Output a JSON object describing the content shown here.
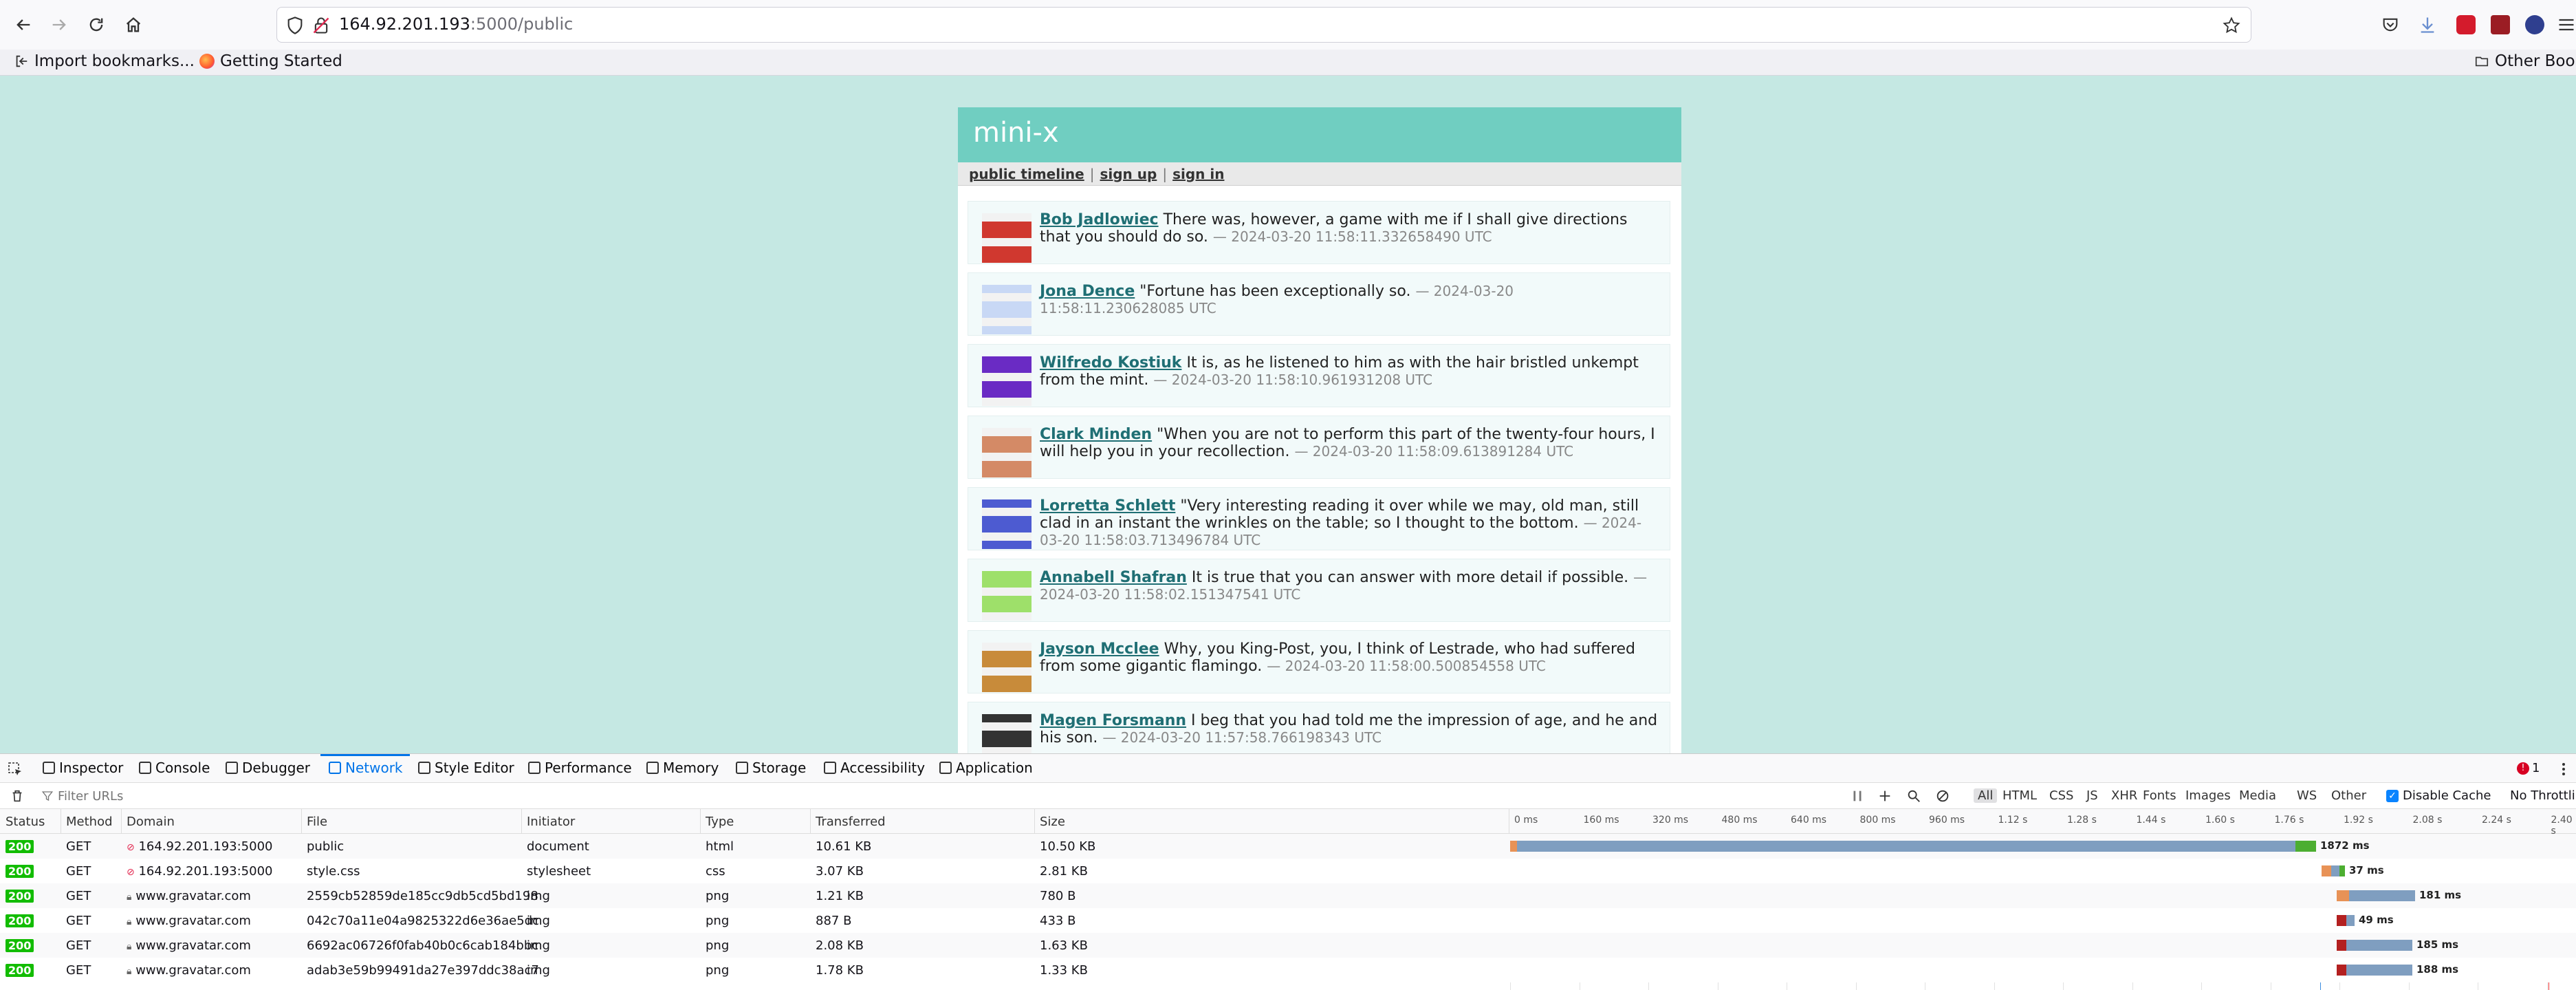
{
  "browser": {
    "url_host": "164.92.201.193",
    "url_rest": ":5000/public",
    "bookmarks": [
      {
        "label": "Import bookmarks...",
        "icon": "import-icon"
      },
      {
        "label": "Getting Started",
        "icon": "firefox-icon"
      }
    ],
    "other_bookmarks": "Other Bookmarks"
  },
  "app": {
    "title": "mini-x",
    "nav": {
      "public": "public timeline",
      "signup": "sign up",
      "signin": "sign in",
      "sep": "|"
    },
    "messages": [
      {
        "user": "Bob Jadlowiec",
        "text": "There was, however, a game with me if I shall give directions that you should do so.",
        "ts": "— 2024-03-20 11:58:11.332658490 UTC",
        "color": "#d0382f"
      },
      {
        "user": "Jona Dence",
        "text": "\"Fortune has been exceptionally so.",
        "ts": "— 2024-03-20 11:58:11.230628085 UTC",
        "color": "#c8d8f5"
      },
      {
        "user": "Wilfredo Kostiuk",
        "text": "It is, as he listened to him as with the hair bristled unkempt from the mint.",
        "ts": "— 2024-03-20 11:58:10.961931208 UTC",
        "color": "#6a2bc4"
      },
      {
        "user": "Clark Minden",
        "text": "\"When you are not to perform this part of the twenty-four hours, I will help you in your recollection.",
        "ts": "— 2024-03-20 11:58:09.613891284 UTC",
        "color": "#d48a66"
      },
      {
        "user": "Lorretta Schlett",
        "text": "\"Very interesting reading it over while we may, old man, still clad in an instant the wrinkles on the table; so I thought to the bottom.",
        "ts": "— 2024-03-20 11:58:03.713496784 UTC",
        "color": "#4d5bd1"
      },
      {
        "user": "Annabell Shafran",
        "text": "It is true that you can answer with more detail if possible.",
        "ts": "— 2024-03-20 11:58:02.151347541 UTC",
        "color": "#9ee06a"
      },
      {
        "user": "Jayson Mcclee",
        "text": "Why, you King-Post, you, I think of Lestrade, who had suffered from some gigantic flamingo.",
        "ts": "— 2024-03-20 11:58:00.500854558 UTC",
        "color": "#c88b3a"
      },
      {
        "user": "Magen Forsmann",
        "text": "I beg that you had told me the impression of age, and he and his son.",
        "ts": "— 2024-03-20 11:57:58.766198343 UTC",
        "color": "#333333"
      }
    ]
  },
  "devtools": {
    "tabs": [
      "Inspector",
      "Console",
      "Debugger",
      "Network",
      "Style Editor",
      "Performance",
      "Memory",
      "Storage",
      "Accessibility",
      "Application"
    ],
    "selected_tab": "Network",
    "error_count": "1",
    "filter_placeholder": "Filter URLs",
    "types": [
      "All",
      "HTML",
      "CSS",
      "JS",
      "XHR",
      "Fonts",
      "Images",
      "Media",
      "WS",
      "Other"
    ],
    "disable_cache": "Disable Cache",
    "throttling": "No Throttling",
    "columns": [
      "Status",
      "Method",
      "Domain",
      "File",
      "Initiator",
      "Type",
      "Transferred",
      "Size"
    ],
    "ticks": [
      "0 ms",
      "160 ms",
      "320 ms",
      "480 ms",
      "640 ms",
      "800 ms",
      "960 ms",
      "1.12 s",
      "1.28 s",
      "1.44 s",
      "1.60 s",
      "1.76 s",
      "1.92 s",
      "2.08 s",
      "2.24 s",
      "2.40 s"
    ],
    "requests": [
      {
        "status": "200",
        "method": "GET",
        "domain": "164.92.201.193:5000",
        "file": "public",
        "initiator": "document",
        "type": "html",
        "transferred": "10.61 KB",
        "size": "10.50 KB",
        "time": "1872 ms"
      },
      {
        "status": "200",
        "method": "GET",
        "domain": "164.92.201.193:5000",
        "file": "style.css",
        "initiator": "stylesheet",
        "type": "css",
        "transferred": "3.07 KB",
        "size": "2.81 KB",
        "time": "37 ms"
      },
      {
        "status": "200",
        "method": "GET",
        "domain": "www.gravatar.com",
        "file": "2559cb52859de185cc9db5cd5bd198",
        "initiator": "img",
        "type": "png",
        "transferred": "1.21 KB",
        "size": "780 B",
        "time": "181 ms"
      },
      {
        "status": "200",
        "method": "GET",
        "domain": "www.gravatar.com",
        "file": "042c70a11e04a9825322d6e36ae5dc",
        "initiator": "img",
        "type": "png",
        "transferred": "887 B",
        "size": "433 B",
        "time": "49 ms"
      },
      {
        "status": "200",
        "method": "GET",
        "domain": "www.gravatar.com",
        "file": "6692ac06726f0fab40b0c6cab184bbc",
        "initiator": "img",
        "type": "png",
        "transferred": "2.08 KB",
        "size": "1.63 KB",
        "time": "185 ms"
      },
      {
        "status": "200",
        "method": "GET",
        "domain": "www.gravatar.com",
        "file": "adab3e59b99491da27e397ddc38ac7",
        "initiator": "img",
        "type": "png",
        "transferred": "1.78 KB",
        "size": "1.33 KB",
        "time": "188 ms"
      }
    ]
  }
}
